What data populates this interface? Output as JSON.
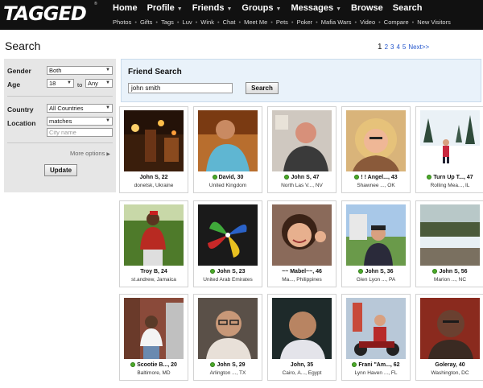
{
  "brand": {
    "logo": "TAGGED",
    "tm": "®"
  },
  "nav": {
    "main": [
      {
        "label": "Home",
        "has_menu": false
      },
      {
        "label": "Profile",
        "has_menu": true
      },
      {
        "label": "Friends",
        "has_menu": true
      },
      {
        "label": "Groups",
        "has_menu": true
      },
      {
        "label": "Messages",
        "has_menu": true
      },
      {
        "label": "Browse",
        "has_menu": false
      },
      {
        "label": "Search",
        "has_menu": false
      }
    ],
    "sub": [
      "Photos",
      "Gifts",
      "Tags",
      "Luv",
      "Wink",
      "Chat",
      "Meet Me",
      "Pets",
      "Poker",
      "Mafia Wars",
      "Video",
      "Compare",
      "New Visitors"
    ]
  },
  "page": {
    "title": "Search"
  },
  "pagination": {
    "current": "1",
    "pages": [
      "2",
      "3",
      "4",
      "5"
    ],
    "next": "Next>>"
  },
  "filters": {
    "gender_label": "Gender",
    "gender_value": "Both",
    "age_label": "Age",
    "age_min": "18",
    "age_to": "to",
    "age_max": "Any",
    "country_label": "Country",
    "country_value": "All Countries",
    "location_label": "Location",
    "location_value": "matches",
    "city_placeholder": "City name",
    "more_options": "More options",
    "update_label": "Update"
  },
  "friend_search": {
    "title": "Friend Search",
    "query": "john smith",
    "button_label": "Search"
  },
  "results": [
    {
      "name": "John S, 22",
      "location": "donetsk, Ukraine",
      "online": false
    },
    {
      "name": "David, 30",
      "location": "United Kingdom",
      "online": true
    },
    {
      "name": "John S, 47",
      "location": "North Las V..., NV",
      "online": true
    },
    {
      "name": "! ! Angel..., 43",
      "location": "Shawnee ..., OK",
      "online": true
    },
    {
      "name": "Turn Up T..., 47",
      "location": "Rolling Mea..., IL",
      "online": true
    },
    {
      "name": "Troy B, 24",
      "location": "st.andrew, Jamaica",
      "online": false
    },
    {
      "name": "John S, 23",
      "location": "United Arab Emirates",
      "online": true
    },
    {
      "name": "~~ Mabel~~, 46",
      "location": "Ma..., Philippines",
      "online": false
    },
    {
      "name": "John S, 36",
      "location": "Glen Lyon ..., PA",
      "online": true
    },
    {
      "name": "John S, 56",
      "location": "Marion ..., NC",
      "online": true
    },
    {
      "name": "Scootie B..., 20",
      "location": "Baltimore, MD",
      "online": true
    },
    {
      "name": "John S, 29",
      "location": "Arlington ..., TX",
      "online": true
    },
    {
      "name": "John, 35",
      "location": "Cairo, A..., Egypt",
      "online": false
    },
    {
      "name": "Frani \"Am..., 62",
      "location": "Lynn Haven ..., FL",
      "online": true
    },
    {
      "name": "Goleray, 40",
      "location": "Washington, DC",
      "online": false
    }
  ],
  "colors": {
    "header_bg": "#111111",
    "link_blue": "#2255cc",
    "online_green": "#4caa2a",
    "search_panel_bg": "#e9f2fa"
  }
}
